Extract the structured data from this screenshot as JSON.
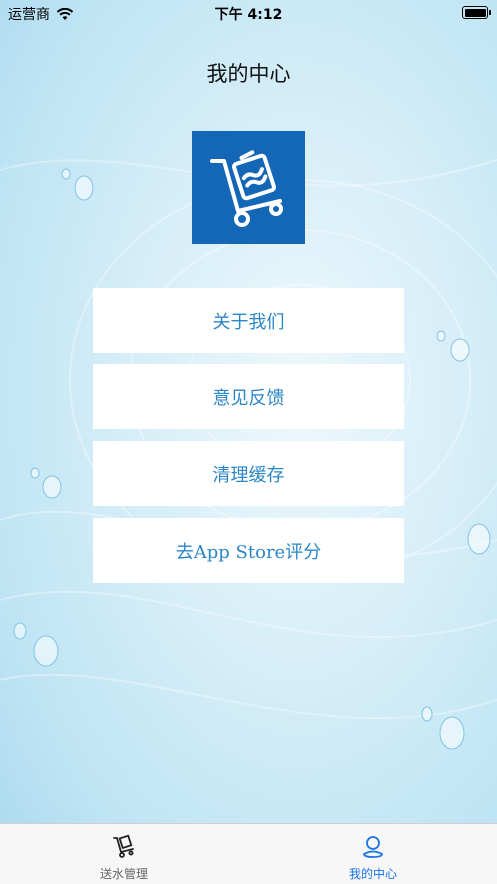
{
  "status_bar": {
    "carrier": "运营商",
    "time": "下午 4:12"
  },
  "page": {
    "title": "我的中心"
  },
  "menu": [
    {
      "label": "关于我们"
    },
    {
      "label": "意见反馈"
    },
    {
      "label": "清理缓存"
    },
    {
      "label": "去App Store评分"
    }
  ],
  "tabbar": {
    "tabs": [
      {
        "label": "送水管理",
        "icon": "delivery-cart-icon",
        "active": false
      },
      {
        "label": "我的中心",
        "icon": "user-icon",
        "active": true
      }
    ]
  },
  "colors": {
    "accent": "#1a73e8",
    "logo_bg": "#1466b6",
    "menu_text": "#2b86c8"
  }
}
